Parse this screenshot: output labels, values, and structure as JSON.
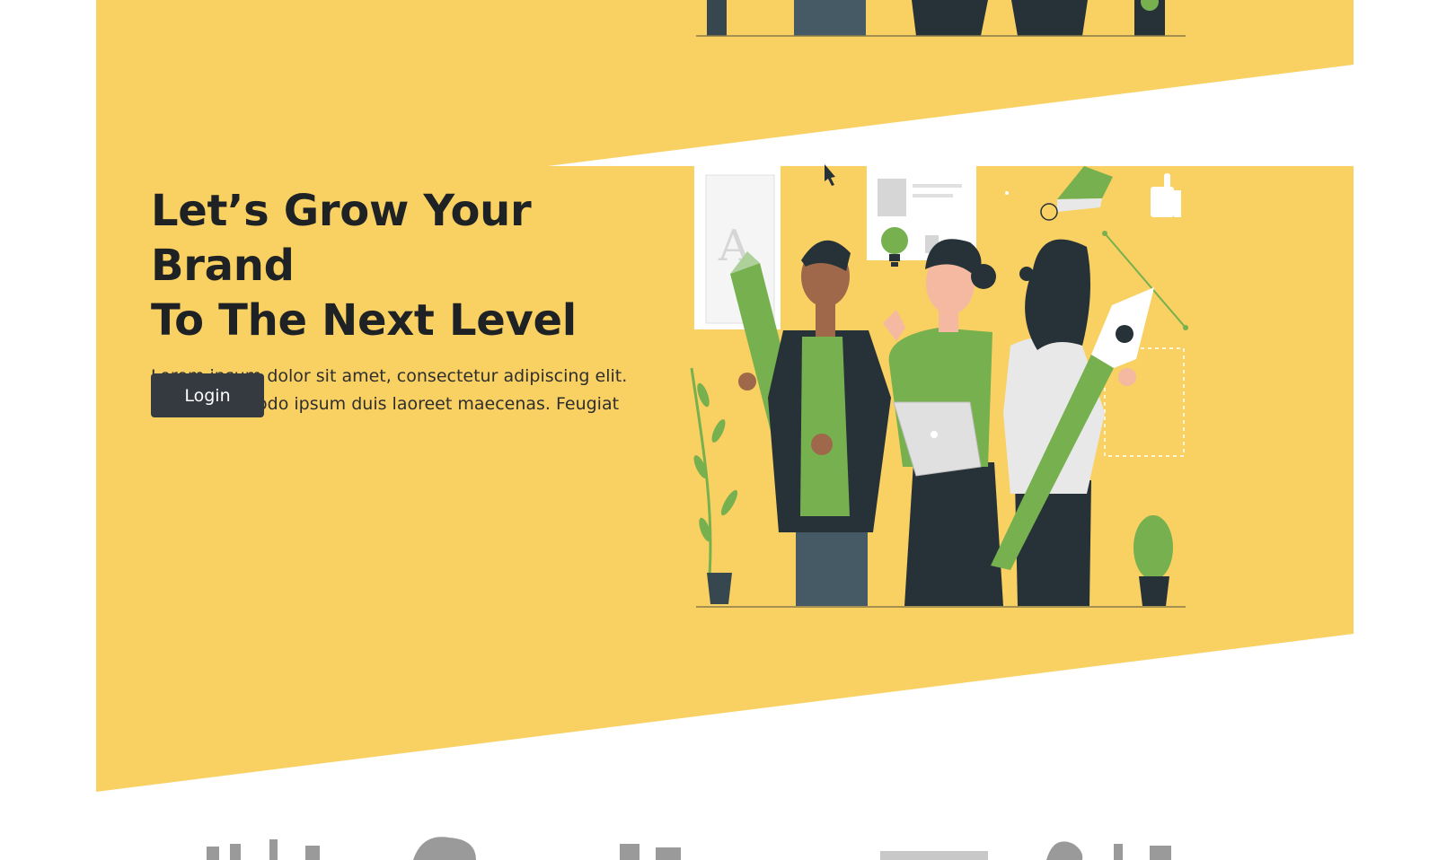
{
  "hero": {
    "title_line1": "Let’s Grow Your Brand",
    "title_line2": "To The Next Level",
    "description": "Lorem ipsum dolor sit amet, consectetur adipiscing elit. Purus commodo ipsum duis laoreet maecenas. Feugiat",
    "login_label": "Login"
  },
  "colors": {
    "hero_background": "#f9d062",
    "button": "#343a40",
    "illustration_green": "#76b04f",
    "illustration_dark": "#263238"
  },
  "icons": [
    "pencil-icon",
    "pen-tool-icon",
    "lightbulb-icon",
    "thumbs-up-icon",
    "color-swatch-icon",
    "cursor-icon",
    "laptop-icon",
    "plant-icon",
    "cactus-icon"
  ]
}
